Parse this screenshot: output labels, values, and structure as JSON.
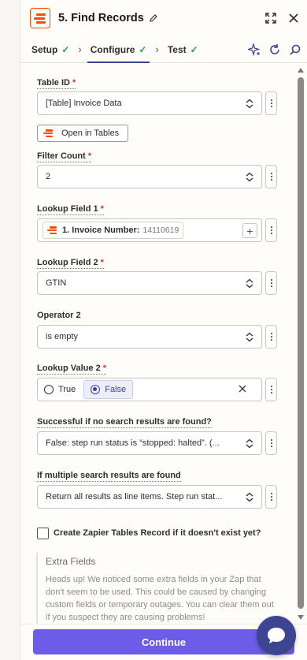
{
  "header": {
    "title": "5. Find Records"
  },
  "tabs": [
    {
      "label": "Setup",
      "done": true
    },
    {
      "label": "Configure",
      "done": true
    },
    {
      "label": "Test",
      "done": true
    }
  ],
  "fields": {
    "table_id": {
      "label": "Table ID",
      "required": "*",
      "value": "[Table] Invoice Data"
    },
    "open_tables": {
      "label": "Open in Tables"
    },
    "filter_count": {
      "label": "Filter Count",
      "required": "*",
      "value": "2"
    },
    "lookup_field_1": {
      "label": "Lookup Field 1",
      "required": "*",
      "pill_label": "1. Invoice Number:",
      "pill_value": "14110619"
    },
    "lookup_field_2": {
      "label": "Lookup Field 2",
      "required": "*",
      "value": "GTIN"
    },
    "operator_2": {
      "label": "Operator 2",
      "value": "is empty"
    },
    "lookup_value_2": {
      "label": "Lookup Value 2",
      "required": "*",
      "option_true": "True",
      "option_false": "False",
      "selected": "False"
    },
    "no_results": {
      "label": "Successful if no search results are found?",
      "value": "False: step run status is “stopped: halted”. (..."
    },
    "multiple": {
      "label": "If multiple search results are found",
      "value": "Return all results as line items. Step run stat..."
    },
    "create_record": {
      "label": "Create Zapier Tables Record if it doesn't exist yet?",
      "checked": false
    }
  },
  "extra_fields": {
    "title": "Extra Fields",
    "body": "Heads up! We noticed some extra fields in your Zap that don't seem to be used. This could be caused by changing custom fields or temporary outages. You can clear them out if you suspect they are causing problems!"
  },
  "footer": {
    "continue_label": "Continue"
  },
  "colors": {
    "accent": "#6d5ce8",
    "brand": "#ff4a00",
    "success": "#1f9d55",
    "required": "#d4351c"
  },
  "icons": [
    "pencil-icon",
    "expand-icon",
    "close-icon",
    "sparkle-icon",
    "refresh-icon",
    "search-icon",
    "chevron-updown-icon",
    "kebab-icon",
    "plus-icon",
    "chat-icon"
  ]
}
